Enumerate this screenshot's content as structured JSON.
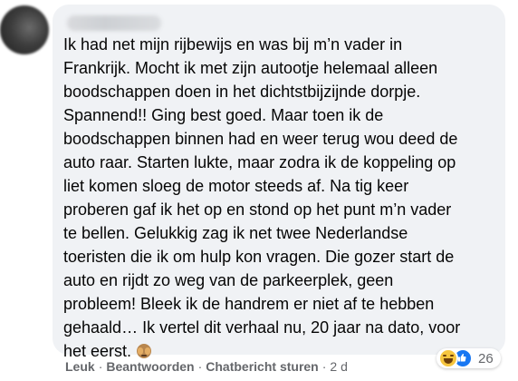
{
  "comment": {
    "author_redacted": true,
    "lines": [
      "Ik had net mijn rijbewijs en was bij m’n vader in",
      "Frankrijk. Mocht ik met zijn autootje helemaal alleen",
      "boodschappen doen in het dichtstbijzijnde dorpje.",
      "Spannend!! Ging best goed. Maar toen ik de",
      "boodschappen binnen had en weer terug wou deed de",
      "auto raar. Starten lukte, maar zodra ik de koppeling op",
      "liet komen sloeg de motor steeds af. Na tig keer",
      "proberen gaf ik het op en stond op het punt m’n vader",
      "te bellen. Gelukkig zag ik net twee Nederlandse",
      "toeristen die ik om hulp kon vragen. Die gozer start de",
      "auto en rijdt zo weg van de parkeerplek, geen",
      "probleem! Bleek ik de handrem er niet af te hebben",
      "gehaald… Ik vertel dit verhaal nu, 20 jaar na dato, voor",
      "het eerst."
    ],
    "trailing_emoji": "see-no-evil-monkey-icon"
  },
  "reactions": {
    "icons": [
      "haha-icon",
      "like-icon"
    ],
    "count": "26"
  },
  "actions": {
    "like": "Leuk",
    "reply": "Beantwoorden",
    "message": "Chatbericht sturen",
    "time": "2 d"
  },
  "colors": {
    "bubble": "#f0f2f5",
    "text": "#050505",
    "meta": "#65676b",
    "like_blue": "#1877f2",
    "haha_yellow": "#f7c63f"
  }
}
